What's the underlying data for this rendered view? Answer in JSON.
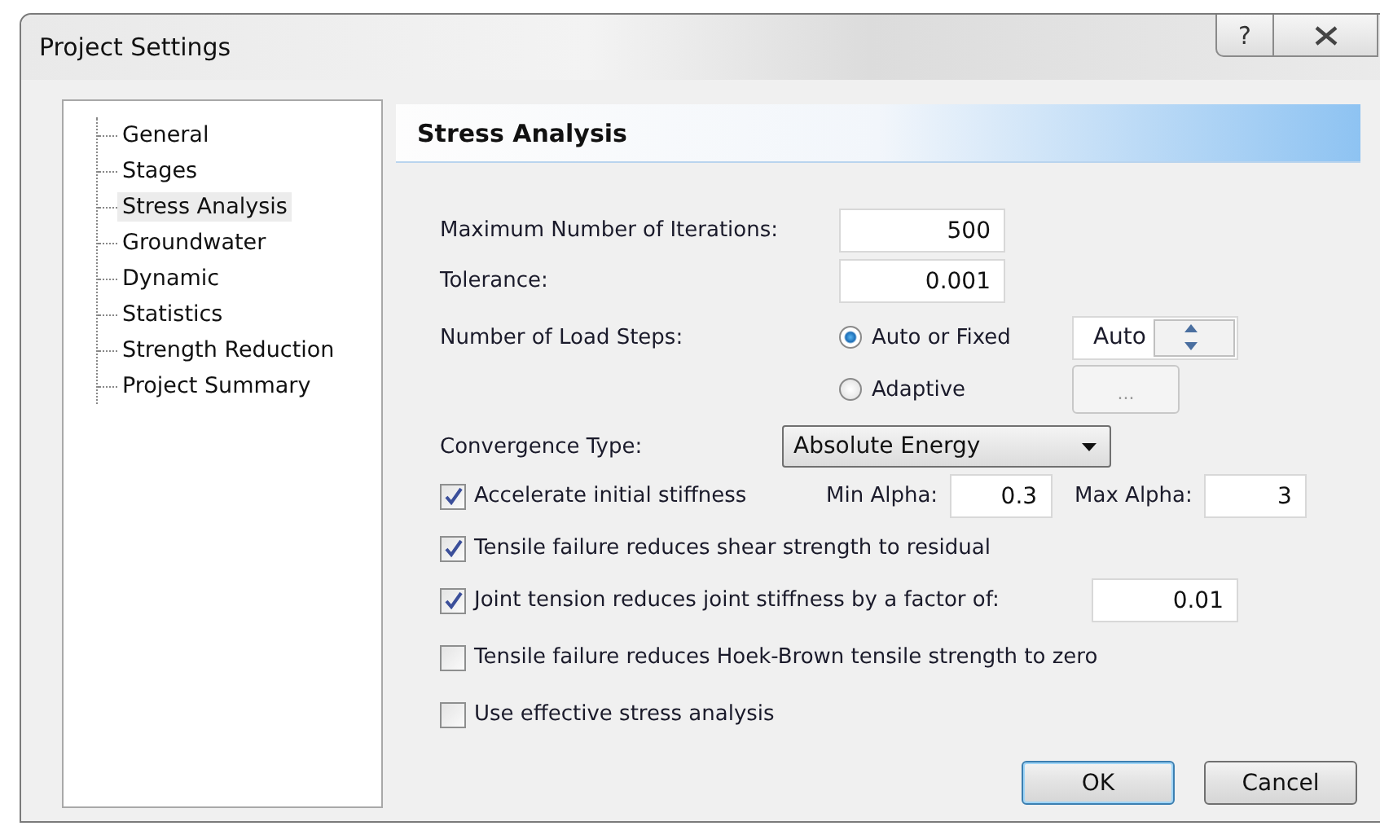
{
  "window": {
    "title": "Project Settings",
    "help_button": "?"
  },
  "tree": {
    "items": [
      {
        "label": "General",
        "selected": false
      },
      {
        "label": "Stages",
        "selected": false
      },
      {
        "label": "Stress Analysis",
        "selected": true
      },
      {
        "label": "Groundwater",
        "selected": false
      },
      {
        "label": "Dynamic",
        "selected": false
      },
      {
        "label": "Statistics",
        "selected": false
      },
      {
        "label": "Strength Reduction",
        "selected": false
      },
      {
        "label": "Project Summary",
        "selected": false
      }
    ]
  },
  "panel": {
    "title": "Stress Analysis"
  },
  "iterations": {
    "label": "Maximum Number of Iterations:",
    "value": "500"
  },
  "tolerance": {
    "label": "Tolerance:",
    "value": "0.001"
  },
  "load_steps": {
    "label": "Number of Load Steps:",
    "options": [
      {
        "label": "Auto or Fixed",
        "selected": true
      },
      {
        "label": "Adaptive",
        "selected": false
      }
    ],
    "spinner_value": "Auto",
    "browse_button": {
      "label": "...",
      "disabled": true
    }
  },
  "convergence": {
    "label": "Convergence Type:",
    "value": "Absolute Energy"
  },
  "checkboxes": [
    {
      "kind": "alpha",
      "label": "Accelerate initial stiffness",
      "checked": true,
      "min_label": "Min Alpha:",
      "min_value": "0.3",
      "max_label": "Max Alpha:",
      "max_value": "3"
    },
    {
      "kind": "plain",
      "label": "Tensile failure reduces shear strength to residual",
      "checked": true
    },
    {
      "kind": "factor",
      "label": "Joint tension reduces joint stiffness by a factor of:",
      "checked": true,
      "value": "0.01"
    },
    {
      "kind": "plain",
      "label": "Tensile failure reduces Hoek-Brown tensile strength  to zero",
      "checked": false
    },
    {
      "kind": "plain",
      "label": "Use effective stress analysis",
      "checked": false
    }
  ],
  "buttons": [
    {
      "label": "OK",
      "default": true
    },
    {
      "label": "Cancel",
      "default": false
    }
  ]
}
